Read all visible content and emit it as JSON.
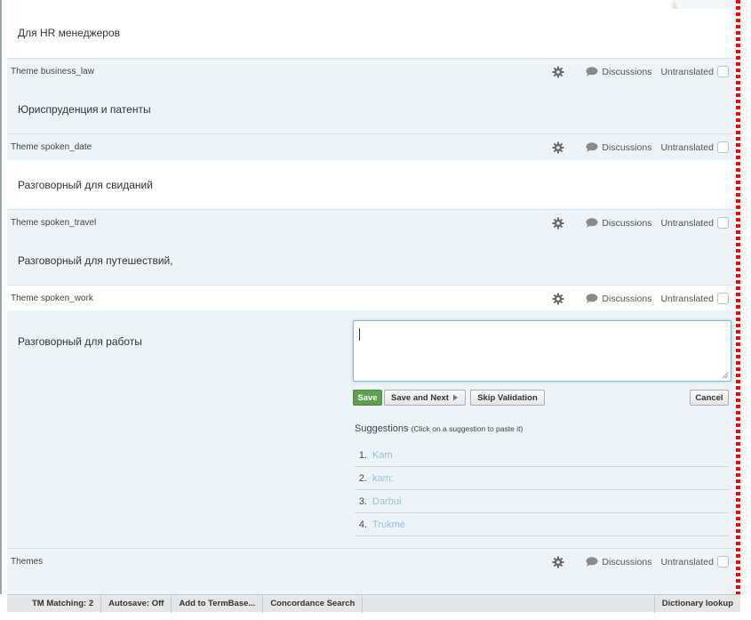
{
  "colors": {
    "accent_save": "#5f9e4e",
    "row_bg": "#edf3f6",
    "suggestion_text": "#9cc0dc",
    "margin_marker": "#e01010"
  },
  "segments": [
    {
      "theme": "",
      "source": "Для HR менеджеров"
    },
    {
      "theme": "Theme business_law",
      "source": "Юриспруденция и патенты"
    },
    {
      "theme": "Theme spoken_date",
      "source": "Разговорный для свиданий"
    },
    {
      "theme": "Theme spoken_travel",
      "source": "Разговорный для путешествий,"
    },
    {
      "theme": "Theme spoken_work",
      "source": "Разговорный для работы"
    },
    {
      "theme": "Themes",
      "source": ""
    }
  ],
  "row_labels": {
    "discussions": "Discussions",
    "untranslated": "Untranslated"
  },
  "editor": {
    "value": ""
  },
  "buttons": {
    "save": "Save",
    "save_next": "Save and Next",
    "skip": "Skip Validation",
    "cancel": "Cancel"
  },
  "suggestions": {
    "title": "Suggestions",
    "hint": "(Click on a suggestion to paste it)",
    "items": [
      {
        "num": "1.",
        "text": "Kam"
      },
      {
        "num": "2.",
        "text": "kam:"
      },
      {
        "num": "3.",
        "text": "Darbui"
      },
      {
        "num": "4.",
        "text": "Trukmė"
      }
    ]
  },
  "statusbar": {
    "tm_matching": "TM Matching: 2",
    "autosave": "Autosave: Off",
    "termbase": "Add to TermBase...",
    "concordance": "Concordance Search",
    "dictionary": "Dictionary lookup"
  }
}
